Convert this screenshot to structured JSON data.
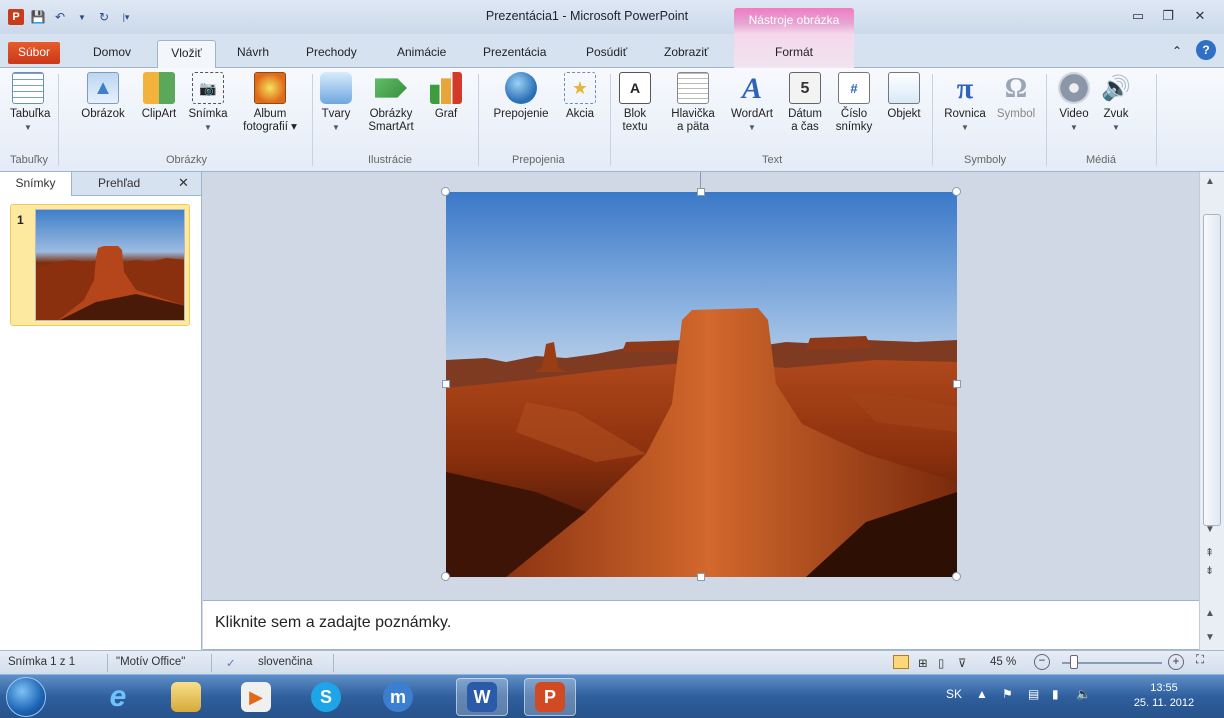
{
  "window": {
    "title": "Prezentácia1 - Microsoft PowerPoint",
    "tool_tab_header": "Nástroje obrázka"
  },
  "tabs": {
    "subor": "Súbor",
    "domov": "Domov",
    "vlozit": "Vložiť",
    "navrh": "Návrh",
    "prechody": "Prechody",
    "animacie": "Animácie",
    "prezentacia": "Prezentácia",
    "posudit": "Posúdiť",
    "zobrazit": "Zobraziť",
    "format": "Formát"
  },
  "ribbon": {
    "groups": {
      "tabulky": "Tabuľky",
      "obrazky": "Obrázky",
      "ilustracie": "Ilustrácie",
      "prepojenia": "Prepojenia",
      "text": "Text",
      "symboly": "Symboly",
      "media": "Médiá"
    },
    "buttons": {
      "tabulka": "Tabuľka",
      "obrazok": "Obrázok",
      "clipart": "ClipArt",
      "snimka": "Snímka",
      "album_1": "Album",
      "album_2": "fotografií",
      "tvary": "Tvary",
      "smartart_1": "Obrázky",
      "smartart_2": "SmartArt",
      "graf": "Graf",
      "prepojenie": "Prepojenie",
      "akcia": "Akcia",
      "blok_1": "Blok",
      "blok_2": "textu",
      "hlavicka_1": "Hlavička",
      "hlavicka_2": "a päta",
      "wordart": "WordArt",
      "datum_1": "Dátum",
      "datum_2": "a čas",
      "cislo_1": "Číslo",
      "cislo_2": "snímky",
      "objekt": "Objekt",
      "rovnica": "Rovnica",
      "symbol": "Symbol",
      "video": "Video",
      "zvuk": "Zvuk"
    }
  },
  "left_panel": {
    "tab_snimky": "Snímky",
    "tab_prehlad": "Prehľad",
    "thumb_number": "1"
  },
  "notes": {
    "placeholder": "Kliknite sem a zadajte poznámky."
  },
  "statusbar": {
    "slide_info": "Snímka 1 z 1",
    "theme": "\"Motív Office\"",
    "language": "slovenčina",
    "zoom": "45 %"
  },
  "taskbar": {
    "lang": "SK",
    "time": "13:55",
    "date": "25. 11. 2012"
  },
  "colors": {
    "accent_file_tab": "#c9381a",
    "tool_tab": "#e5a6d3",
    "ribbon_bg": "#e4ecf7"
  },
  "icons": [
    "powerpoint-icon",
    "save-icon",
    "undo-icon",
    "redo-icon",
    "table-icon",
    "picture-icon",
    "clipart-icon",
    "screenshot-icon",
    "photo-album-icon",
    "shapes-icon",
    "smartart-icon",
    "chart-icon",
    "hyperlink-icon",
    "action-icon",
    "textbox-icon",
    "header-footer-icon",
    "wordart-icon",
    "date-time-icon",
    "slide-number-icon",
    "object-icon",
    "equation-icon",
    "symbol-icon",
    "video-icon",
    "audio-icon",
    "close-icon",
    "help-icon"
  ]
}
